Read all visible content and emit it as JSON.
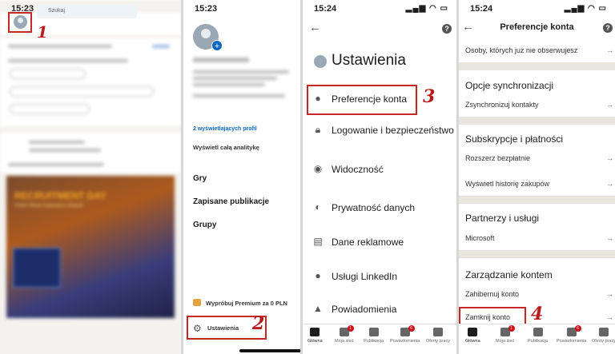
{
  "panel1": {
    "time": "15:23",
    "search_placeholder": "Szukaj",
    "annotation": "1"
  },
  "panel2": {
    "time": "15:23",
    "profile_viewers": "2 wyświetlających profil",
    "view_analytics": "Wyświetl całą analitykę",
    "menu": [
      "Gry",
      "Zapisane publikacje",
      "Grupy"
    ],
    "premium": "Wypróbuj Premium za 0 PLN",
    "settings": "Ustawienia",
    "annotation": "2"
  },
  "panel3": {
    "time": "15:24",
    "title": "Ustawienia",
    "items": [
      {
        "label": "Preferencje konta",
        "icon": "person-icon"
      },
      {
        "label": "Logowanie i bezpieczeństwo",
        "icon": "lock-icon"
      },
      {
        "label": "Widoczność",
        "icon": "eye-icon"
      },
      {
        "label": "Prywatność danych",
        "icon": "shield-icon"
      },
      {
        "label": "Dane reklamowe",
        "icon": "ad-icon"
      },
      {
        "label": "Usługi LinkedIn",
        "icon": "person-icon"
      },
      {
        "label": "Powiadomienia",
        "icon": "bell-icon"
      }
    ],
    "annotation": "3"
  },
  "panel4": {
    "time": "15:24",
    "title": "Preferencje konta",
    "top_row": "Osoby, których już nie obserwujesz",
    "sections": [
      {
        "title": "Opcje synchronizacji",
        "rows": [
          "Zsynchronizuj kontakty"
        ]
      },
      {
        "title": "Subskrypcje i płatności",
        "rows": [
          "Rozszerz bezpłatnie",
          "Wyświetl historię zakupów"
        ]
      },
      {
        "title": "Partnerzy i usługi",
        "rows": [
          "Microsoft"
        ]
      },
      {
        "title": "Zarządzanie kontem",
        "rows": [
          "Zahibernuj konto",
          "Zamknij konto"
        ]
      }
    ],
    "annotation": "4"
  },
  "tabs": [
    {
      "label": "Główna",
      "badge": ""
    },
    {
      "label": "Moja sieć",
      "badge": "1"
    },
    {
      "label": "Publikacja",
      "badge": ""
    },
    {
      "label": "Powiadomienia",
      "badge": "6"
    },
    {
      "label": "Oferty pracy",
      "badge": ""
    }
  ],
  "colors": {
    "annotation": "#c62828",
    "linkedin_blue": "#0a66c2"
  }
}
